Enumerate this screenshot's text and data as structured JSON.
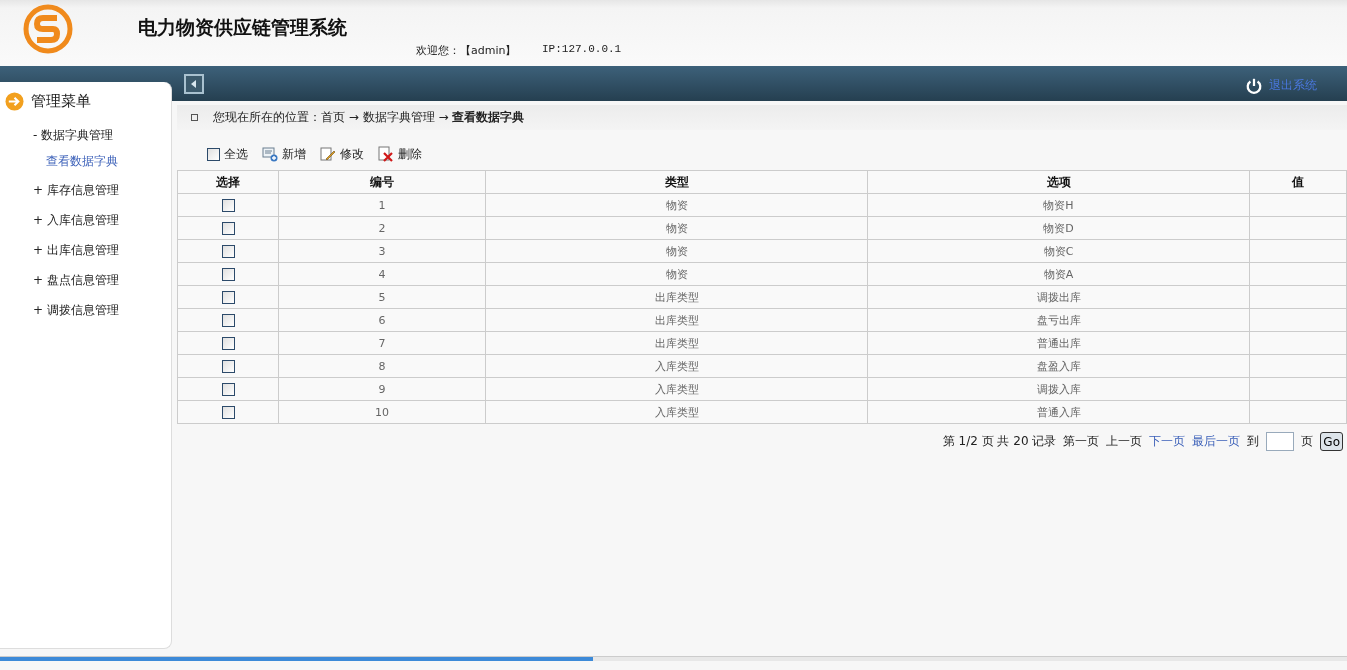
{
  "header": {
    "title": "电力物资供应链管理系统",
    "welcome": "欢迎您：【admin】",
    "ip": "IP:127.0.0.1"
  },
  "topbar": {
    "logout": "退出系统"
  },
  "sidebar": {
    "title": "管理菜单",
    "items": [
      {
        "label": "数据字典管理",
        "expander": "-",
        "children": [
          {
            "label": "查看数据字典",
            "selected": true
          }
        ]
      },
      {
        "label": "库存信息管理",
        "expander": "+"
      },
      {
        "label": "入库信息管理",
        "expander": "+"
      },
      {
        "label": "出库信息管理",
        "expander": "+"
      },
      {
        "label": "盘点信息管理",
        "expander": "+"
      },
      {
        "label": "调拨信息管理",
        "expander": "+"
      }
    ]
  },
  "breadcrumb": {
    "prefix": "您现在所在的位置：首页 → 数据字典管理 →",
    "current": "查看数据字典"
  },
  "toolbar": {
    "select_all": {
      "label": "全选",
      "checked": false
    },
    "actions": [
      {
        "kind": "add",
        "label": "新增"
      },
      {
        "kind": "edit",
        "label": "修改"
      },
      {
        "kind": "delete",
        "label": "删除"
      }
    ]
  },
  "table": {
    "columns": [
      "选择",
      "编号",
      "类型",
      "选项",
      "值"
    ],
    "rows": [
      {
        "checked": false,
        "cells": [
          "",
          "1",
          "物资",
          "物资H",
          ""
        ]
      },
      {
        "checked": false,
        "cells": [
          "",
          "2",
          "物资",
          "物资D",
          ""
        ]
      },
      {
        "checked": false,
        "cells": [
          "",
          "3",
          "物资",
          "物资C",
          ""
        ]
      },
      {
        "checked": false,
        "cells": [
          "",
          "4",
          "物资",
          "物资A",
          ""
        ]
      },
      {
        "checked": false,
        "cells": [
          "",
          "5",
          "出库类型",
          "调拨出库",
          ""
        ]
      },
      {
        "checked": false,
        "cells": [
          "",
          "6",
          "出库类型",
          "盘亏出库",
          ""
        ]
      },
      {
        "checked": false,
        "cells": [
          "",
          "7",
          "出库类型",
          "普通出库",
          ""
        ]
      },
      {
        "checked": false,
        "cells": [
          "",
          "8",
          "入库类型",
          "盘盈入库",
          ""
        ]
      },
      {
        "checked": false,
        "cells": [
          "",
          "9",
          "入库类型",
          "调拨入库",
          ""
        ]
      },
      {
        "checked": false,
        "cells": [
          "",
          "10",
          "入库类型",
          "普通入库",
          ""
        ]
      }
    ]
  },
  "pagination": {
    "summary": "第 1/2 页 共 20 记录",
    "links": [
      {
        "label": "第一页",
        "disabled": true
      },
      {
        "label": "上一页",
        "disabled": true
      },
      {
        "label": "下一页",
        "disabled": false
      },
      {
        "label": "最后一页",
        "disabled": false
      }
    ],
    "goto_prefix": "到",
    "goto_suffix": "页",
    "go": "Go"
  },
  "loading_bar": {
    "level": 0.44
  }
}
